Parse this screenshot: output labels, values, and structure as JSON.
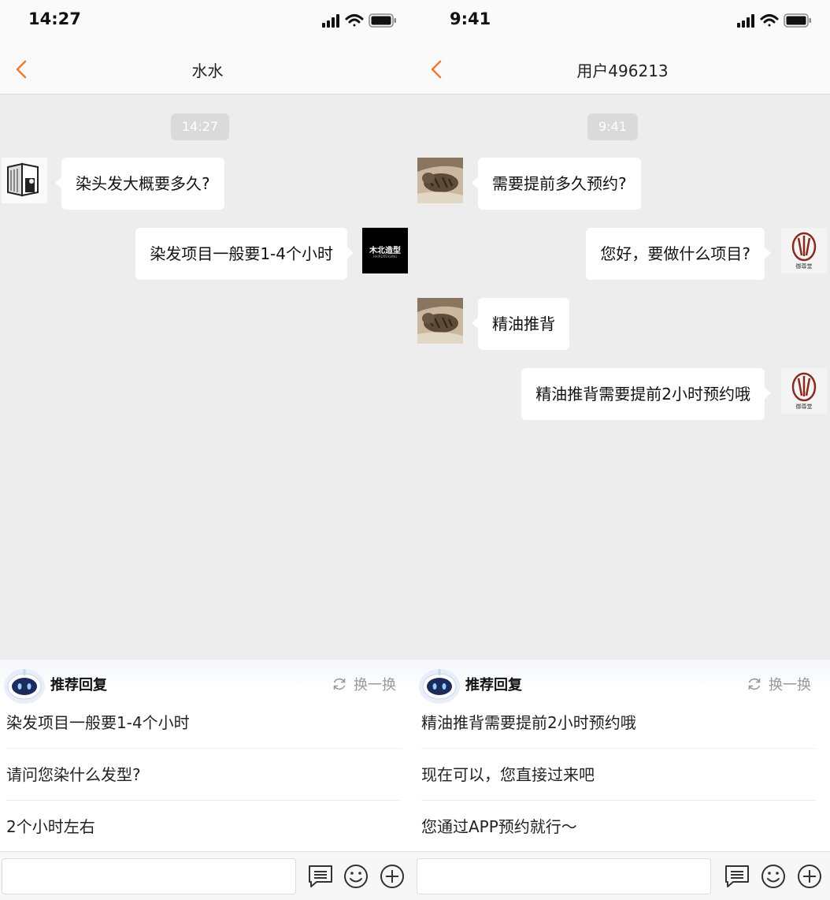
{
  "left": {
    "status_time": "14:27",
    "title": "水水",
    "timestamp": "14:27",
    "messages": [
      {
        "side": "in",
        "text": "染头发大概要多久?"
      },
      {
        "side": "out",
        "text": "染发项目一般要1-4个小时"
      }
    ],
    "avatar_logo_text": "木北造型",
    "avatar_logo_sub": "HAIRDRESSING",
    "suggest_title": "推荐回复",
    "refresh_label": "换一换",
    "suggestions": [
      "染发项目一般要1-4个小时",
      "请问您染什么发型?",
      "2个小时左右"
    ]
  },
  "right": {
    "status_time": "9:41",
    "title": "用户496213",
    "timestamp": "9:41",
    "messages": [
      {
        "side": "in",
        "text": "需要提前多久预约?"
      },
      {
        "side": "out",
        "text": "您好，要做什么项目?"
      },
      {
        "side": "in",
        "text": "精油推背"
      },
      {
        "side": "out",
        "text": "精油推背需要提前2小时预约哦"
      }
    ],
    "avatar_logo_text": "御尊堂",
    "suggest_title": "推荐回复",
    "refresh_label": "换一换",
    "suggestions": [
      "精油推背需要提前2小时预约哦",
      "现在可以，您直接过来吧",
      "您通过APP预约就行～"
    ]
  },
  "colors": {
    "accent": "#f07a3a",
    "chat_bg": "#ededed",
    "bubble": "#ffffff"
  },
  "icons": [
    "back-chevron-icon",
    "signal-icon",
    "wifi-icon",
    "battery-icon",
    "robot-icon",
    "refresh-icon",
    "quick-phrase-icon",
    "emoji-icon",
    "add-icon"
  ]
}
